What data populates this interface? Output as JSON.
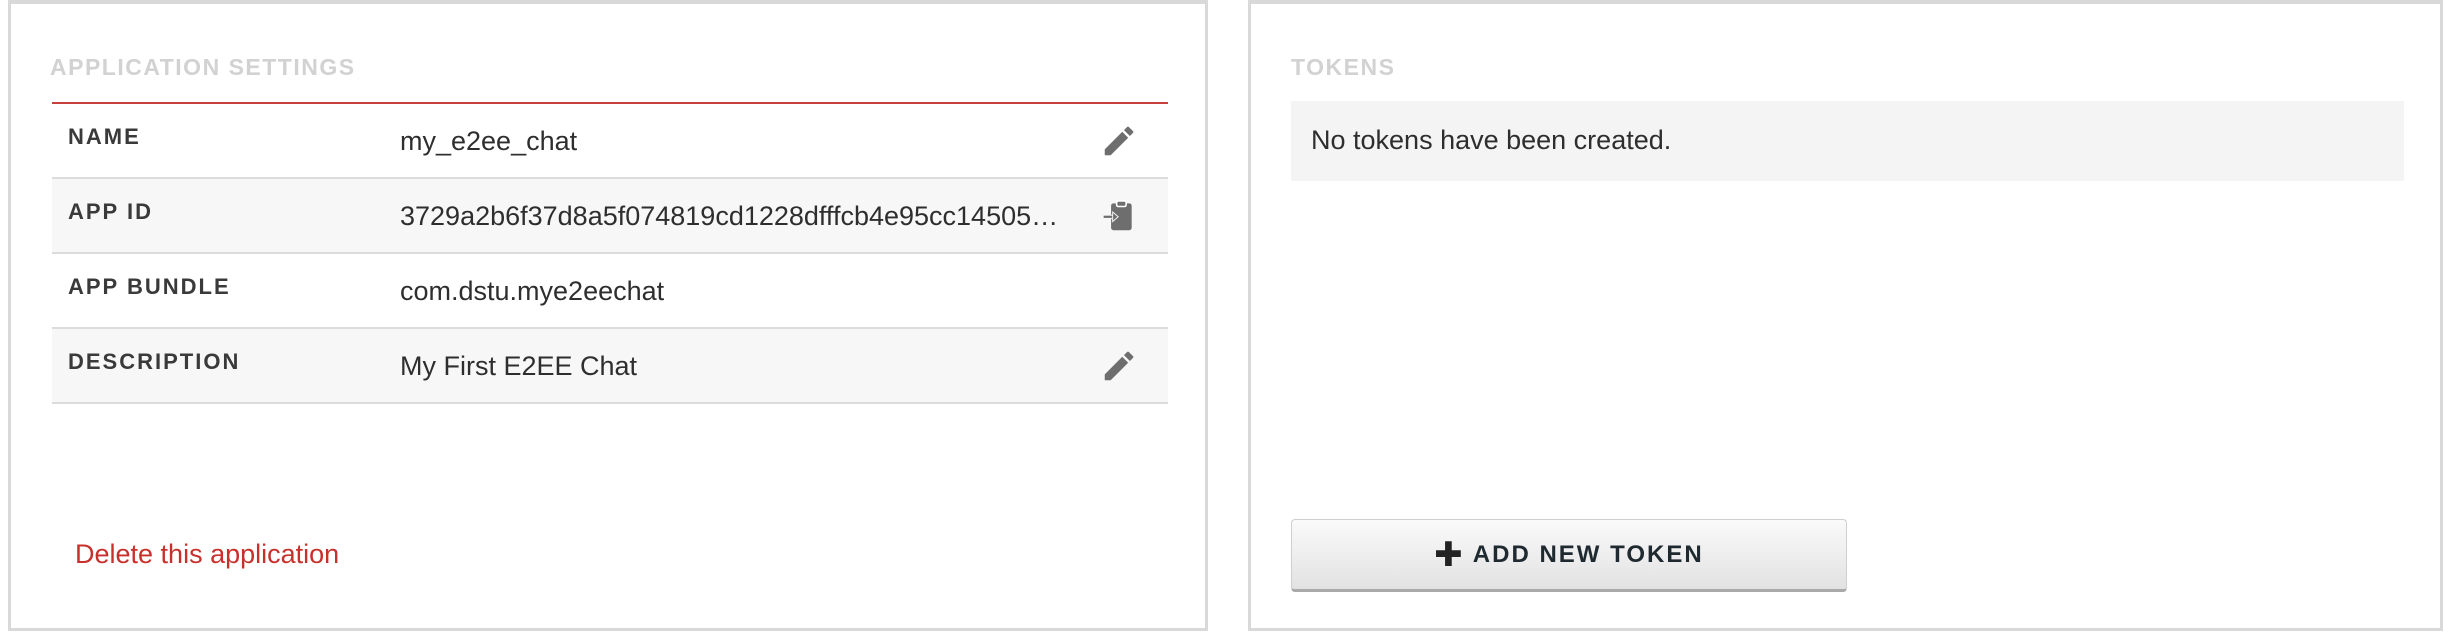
{
  "settings": {
    "title": "APPLICATION SETTINGS",
    "rows": [
      {
        "label": "NAME",
        "value": "my_e2ee_chat",
        "icon": "pencil-icon"
      },
      {
        "label": "APP ID",
        "value": "3729a2b6f37d8a5f074819cd1228dfffcb4e95cc14505…",
        "icon": "clipboard-icon"
      },
      {
        "label": "APP BUNDLE",
        "value": "com.dstu.mye2eechat"
      },
      {
        "label": "DESCRIPTION",
        "value": "My First E2EE Chat",
        "icon": "pencil-icon"
      }
    ],
    "delete_label": "Delete this application"
  },
  "tokens": {
    "title": "TOKENS",
    "empty_message": "No tokens have been created.",
    "add_button_label": "ADD NEW TOKEN"
  },
  "colors": {
    "accent_red": "#c8403c",
    "muted_title": "#d2d2d2",
    "icon_gray": "#6e6e6e"
  }
}
